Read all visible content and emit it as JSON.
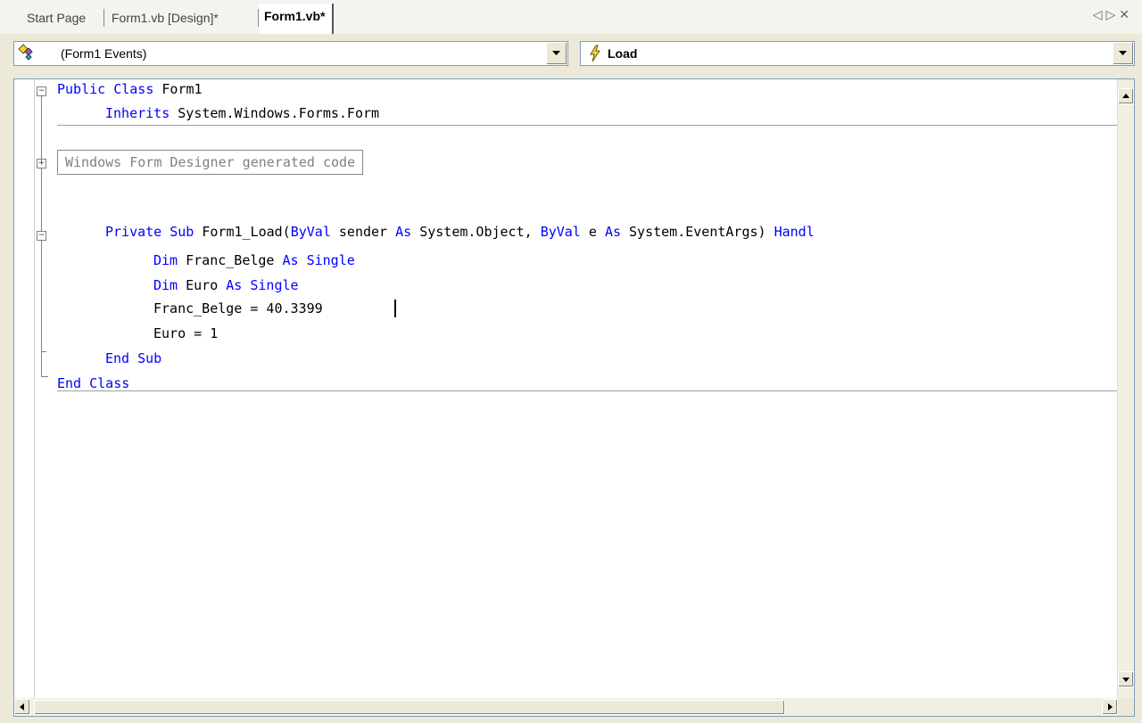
{
  "tabs": {
    "start": "Start Page",
    "design": "Form1.vb [Design]*",
    "code": "Form1.vb*",
    "nav_left": "◁",
    "nav_right": "▷",
    "close": "✕"
  },
  "class_combo": {
    "value": "(Form1 Events)"
  },
  "method_combo": {
    "value": "Load"
  },
  "code": {
    "lines": {
      "l1a": "Public",
      "l1b": " Class",
      "l1c": " Form1",
      "l2a": "Inherits",
      "l2b": " System.Windows.Forms.Form",
      "region": "Windows Form Designer generated code",
      "l6a": "Private",
      "l6b": " Sub",
      "l6c": " Form1_Load(",
      "l6d": "ByVal",
      "l6e": " sender ",
      "l6f": "As",
      "l6g": " System.Object, ",
      "l6h": "ByVal",
      "l6i": " e ",
      "l6j": "As",
      "l6k": " System.EventArgs) ",
      "l6l": "Handl",
      "l7a": "Dim",
      "l7b": " Franc_Belge ",
      "l7c": "As",
      "l7d": " Single",
      "l8a": "Dim",
      "l8b": " Euro ",
      "l8c": "As",
      "l8d": " Single",
      "l9": "Franc_Belge = 40.3399",
      "l10": "Euro = 1",
      "l11a": "End",
      "l11b": " Sub",
      "l12a": "End",
      "l12b": " Class"
    }
  },
  "colors": {
    "keyword": "#0000ff",
    "text": "#000000",
    "region": "#808080"
  }
}
